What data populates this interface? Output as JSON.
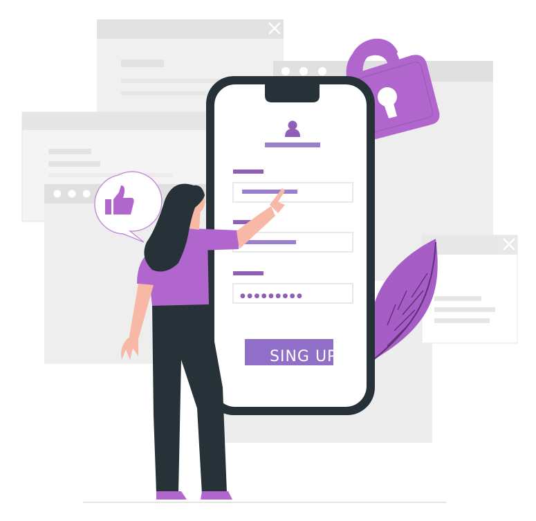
{
  "form": {
    "submit_label": "SING UP",
    "password_mask": "●●●●●●●●●"
  },
  "colors": {
    "accent": "#b066cc",
    "accent_dark": "#8f5fb8",
    "bar": "#9b7fcf",
    "phone_frame": "#263238",
    "window_gray": "#e6e6e6",
    "window_light": "#f0f0f0"
  },
  "icons": {
    "window_close": "close-icon",
    "padlock": "padlock-icon",
    "thumbs_up": "thumbs-up-icon",
    "user": "user-icon"
  }
}
